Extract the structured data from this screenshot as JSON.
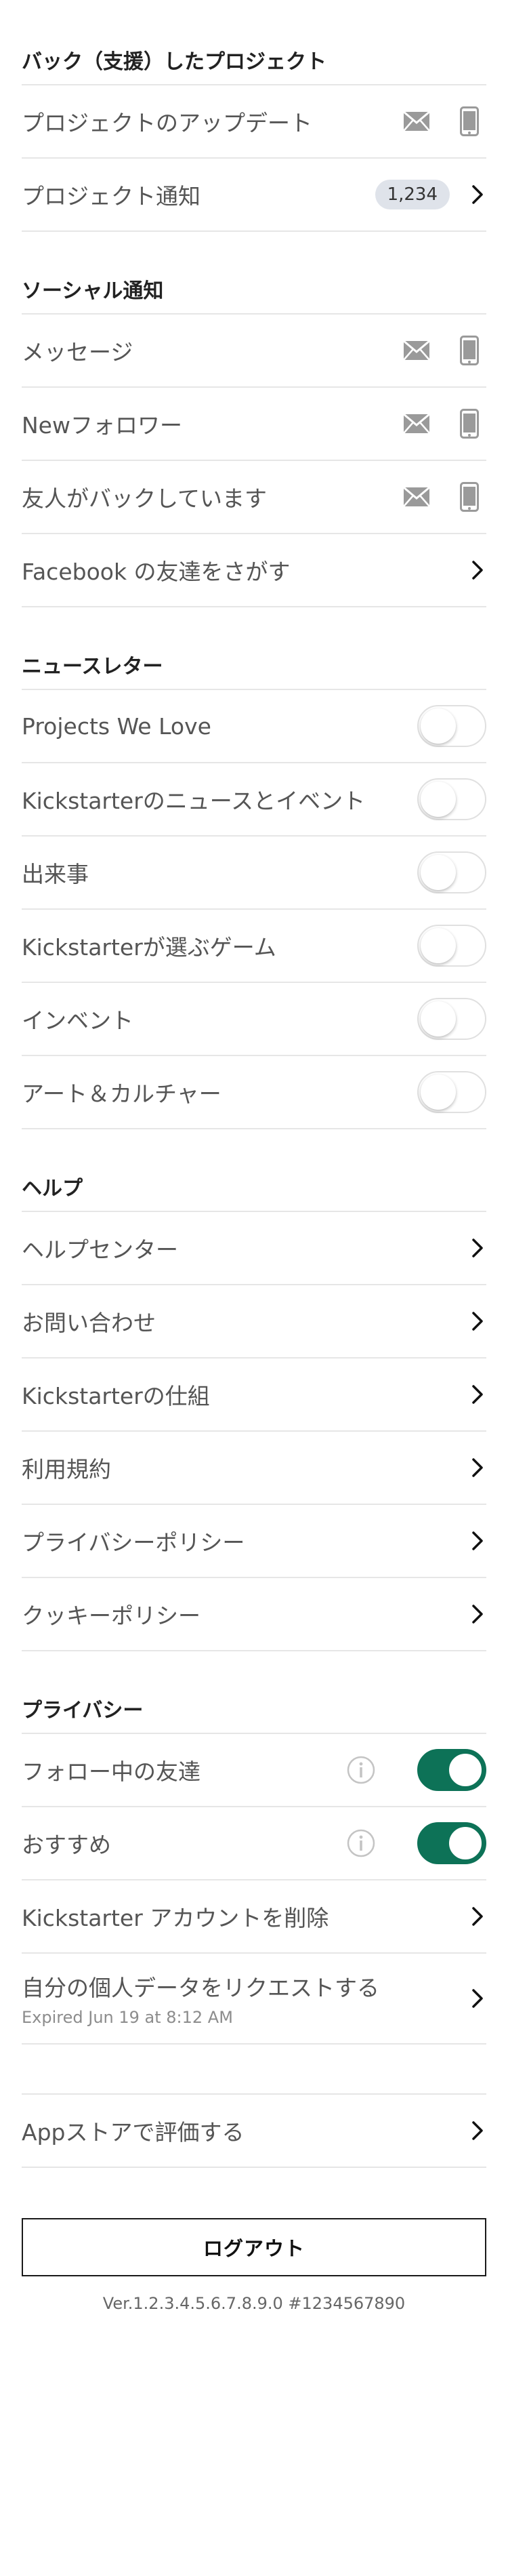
{
  "backed_projects": {
    "title": "バック（支援）したプロジェクト",
    "items": [
      {
        "label": "プロジェクトのアップデート"
      },
      {
        "label": "プロジェクト通知",
        "badge": "1,234"
      }
    ]
  },
  "social": {
    "title": "ソーシャル通知",
    "items": [
      {
        "label": "メッセージ"
      },
      {
        "label": "Newフォロワー"
      },
      {
        "label": "友人がバックしています"
      },
      {
        "label": "Facebook の友達をさがす"
      }
    ]
  },
  "newsletter": {
    "title": "ニュースレター",
    "items": [
      {
        "label": "Projects We Love",
        "enabled": false
      },
      {
        "label": "Kickstarterのニュースとイベント",
        "enabled": false
      },
      {
        "label": "出来事",
        "enabled": false
      },
      {
        "label": "Kickstarterが選ぶゲーム",
        "enabled": false
      },
      {
        "label": "インベント",
        "enabled": false
      },
      {
        "label": "アート＆カルチャー",
        "enabled": false
      }
    ]
  },
  "help": {
    "title": "ヘルプ",
    "items": [
      {
        "label": "ヘルプセンター"
      },
      {
        "label": "お問い合わせ"
      },
      {
        "label": "Kickstarterの仕組"
      },
      {
        "label": "利用規約"
      },
      {
        "label": "プライバシーポリシー"
      },
      {
        "label": "クッキーポリシー"
      }
    ]
  },
  "privacy": {
    "title": "プライバシー",
    "items": [
      {
        "label": "フォロー中の友達",
        "enabled": true
      },
      {
        "label": "おすすめ",
        "enabled": true
      },
      {
        "label": "Kickstarter アカウントを削除"
      },
      {
        "label": "自分の個人データをリクエストする",
        "sub": "Expired Jun 19 at 8:12 AM"
      }
    ]
  },
  "rate": {
    "label": "Appストアで評価する"
  },
  "logout": {
    "label": "ログアウト"
  },
  "version": "Ver.1.2.3.4.5.6.7.8.9.0 #1234567890",
  "colors": {
    "accent": "#0d7257",
    "divider": "#e6e6e6",
    "badge_bg": "#dfe3ea"
  }
}
